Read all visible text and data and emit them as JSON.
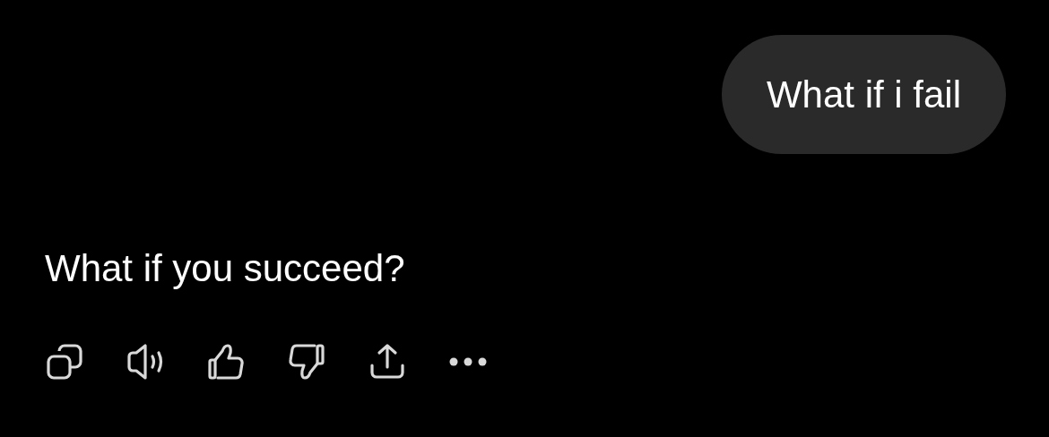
{
  "messages": [
    {
      "kind": "user",
      "text": "What if i fail"
    },
    {
      "kind": "assistant",
      "text": "What if you succeed?"
    }
  ]
}
